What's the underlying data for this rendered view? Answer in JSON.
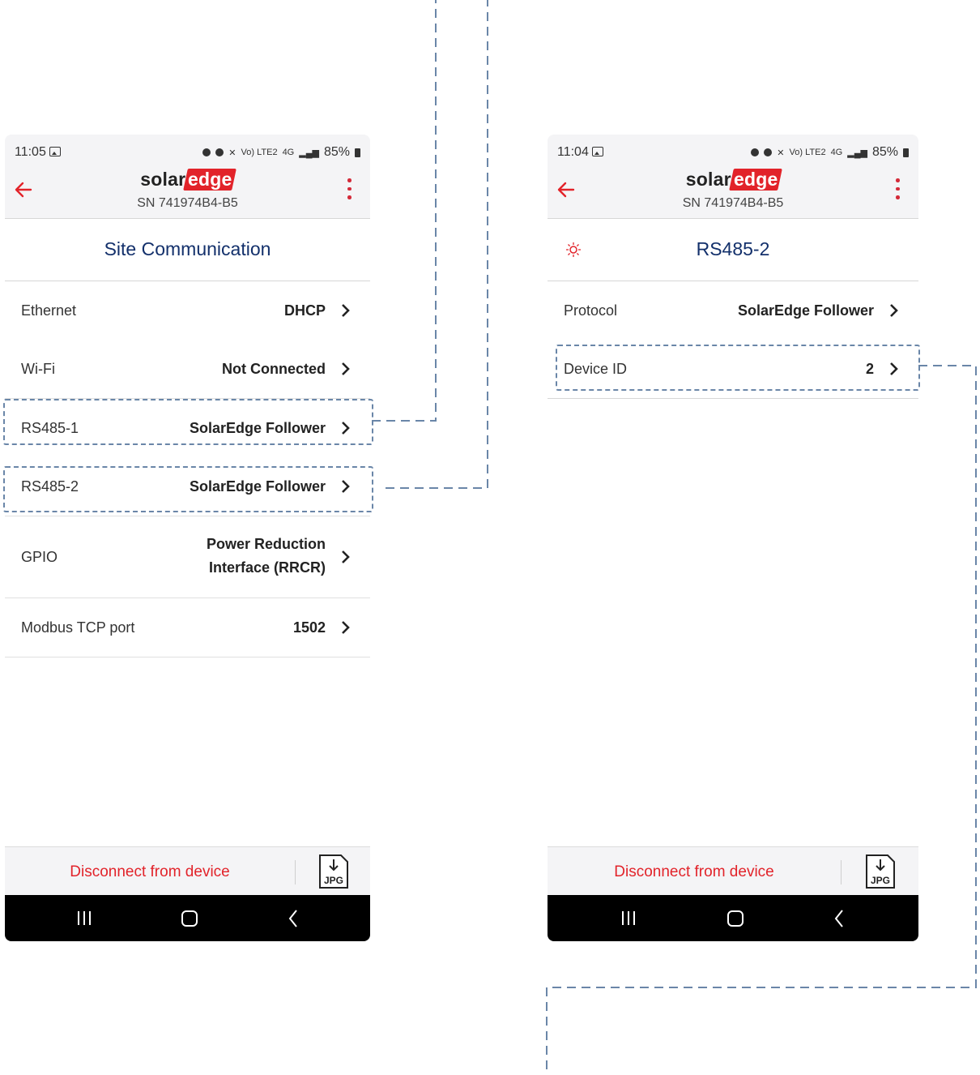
{
  "left_screen": {
    "status": {
      "time": "11:05",
      "lte": "Vo) LTE2",
      "net": "4G",
      "battery": "85%"
    },
    "header": {
      "logo_solar": "solar",
      "logo_edge": "edge",
      "serial": "SN 741974B4-B5"
    },
    "title": "Site Communication",
    "rows": [
      {
        "label": "Ethernet",
        "value": "DHCP"
      },
      {
        "label": "Wi-Fi",
        "value": "Not Connected"
      },
      {
        "label": "RS485-1",
        "value": "SolarEdge Follower"
      },
      {
        "label": "RS485-2",
        "value": "SolarEdge Follower"
      },
      {
        "label": "GPIO",
        "value_line1": "Power Reduction",
        "value_line2": "Interface (RRCR)"
      },
      {
        "label": "Modbus TCP port",
        "value": "1502"
      }
    ],
    "footer": {
      "disconnect": "Disconnect from device",
      "jpg": "JPG"
    }
  },
  "right_screen": {
    "status": {
      "time": "11:04",
      "lte": "Vo) LTE2",
      "net": "4G",
      "battery": "85%"
    },
    "header": {
      "logo_solar": "solar",
      "logo_edge": "edge",
      "serial": "SN 741974B4-B5"
    },
    "title": "RS485-2",
    "rows": [
      {
        "label": "Protocol",
        "value": "SolarEdge Follower"
      },
      {
        "label": "Device ID",
        "value": "2"
      }
    ],
    "footer": {
      "disconnect": "Disconnect from device",
      "jpg": "JPG"
    }
  },
  "colors": {
    "accent": "#e2232a",
    "title": "#13306b",
    "dash": "#6a86a8"
  }
}
